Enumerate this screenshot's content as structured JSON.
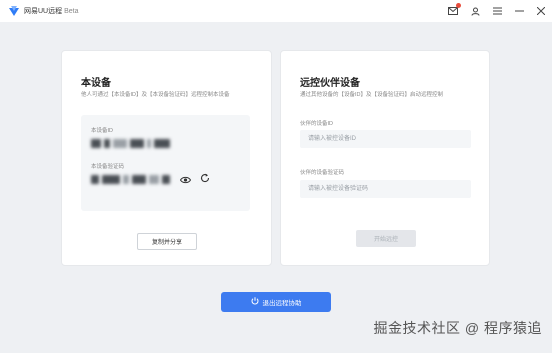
{
  "titlebar": {
    "app_name": "网易UU远程",
    "badge": "Beta",
    "icons": [
      "logo-icon",
      "mail-icon",
      "user-icon",
      "menu-icon",
      "minimize-icon",
      "close-icon"
    ]
  },
  "local_device": {
    "title": "本设备",
    "subtitle": "他人可通过【本设备ID】及【本设备验证码】远程控制本设备",
    "id_label": "本设备ID",
    "code_label": "本设备验证码",
    "share_button": "复制并分享"
  },
  "remote_device": {
    "title": "远控伙伴设备",
    "subtitle": "通过其他设备的【设备ID】及【设备验证码】启动远程控制",
    "id_label": "伙伴的设备ID",
    "id_placeholder": "请输入被控设备ID",
    "code_label": "伙伴的设备验证码",
    "code_placeholder": "请输入被控设备验证码",
    "start_button": "开始远控"
  },
  "footer": {
    "exit_button": "退出远程协助"
  },
  "watermark": "掘金技术社区 @ 程序猿追",
  "colors": {
    "accent": "#3d7bf0",
    "background": "#eef0f3",
    "notification": "#e74c3c"
  }
}
